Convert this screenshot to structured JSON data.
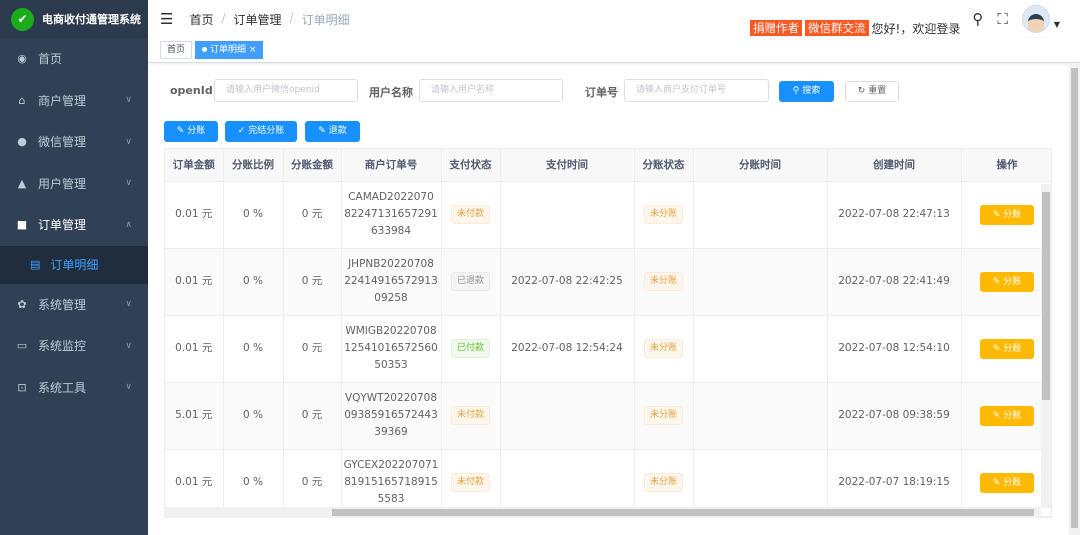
{
  "app": {
    "title": "电商收付通管理系统",
    "logo_icon": "wechat-pay-icon"
  },
  "sidebar": {
    "items": [
      {
        "label": "首页",
        "icon": "dashboard-icon"
      },
      {
        "label": "商户管理",
        "icon": "shop-icon"
      },
      {
        "label": "微信管理",
        "icon": "wechat-icon"
      },
      {
        "label": "用户管理",
        "icon": "user-icon"
      },
      {
        "label": "订单管理",
        "icon": "order-icon",
        "expanded": true
      },
      {
        "label": "系统管理",
        "icon": "gear-icon"
      },
      {
        "label": "系统监控",
        "icon": "monitor-icon"
      },
      {
        "label": "系统工具",
        "icon": "toolbox-icon"
      }
    ],
    "active_sub": "订单明细"
  },
  "header": {
    "breadcrumb": [
      "首页",
      "订单管理",
      "订单明细"
    ],
    "donate": "捐赠作者",
    "wechat_group": "微信群交流",
    "greeting": "您好!，欢迎登录"
  },
  "tags": {
    "home": "首页",
    "active": "订单明细"
  },
  "search": {
    "openid_label": "openId",
    "openid_placeholder": "请输入用户微信openid",
    "username_label": "用户名称",
    "username_placeholder": "请输入用户名称",
    "order_label": "订单号",
    "order_placeholder": "请输入商户支付订单号",
    "search_btn": "搜索",
    "reset_btn": "重置"
  },
  "actions": {
    "split": "分账",
    "finish_split": "完结分账",
    "refund": "退款"
  },
  "table": {
    "headers": [
      "订单金额",
      "分账比例",
      "分账金额",
      "商户订单号",
      "支付状态",
      "支付时间",
      "分账状态",
      "分账时间",
      "创建时间",
      "操作"
    ],
    "op_label": "分账",
    "rows": [
      {
        "amount": "0.01 元",
        "ratio": "0 %",
        "split_amount": "0 元",
        "order_no": [
          "CAMAD2022070",
          "82247131657291",
          "633984"
        ],
        "pay_status": "未付款",
        "pay_type": "unpaid",
        "pay_time": "",
        "split_status": "未分账",
        "split_time": "",
        "created": "2022-07-08 22:47:13"
      },
      {
        "amount": "0.01 元",
        "ratio": "0 %",
        "split_amount": "0 元",
        "order_no": [
          "JHPNB20220708",
          "22414916572913",
          "09258"
        ],
        "pay_status": "已退款",
        "pay_type": "refund",
        "pay_time": "2022-07-08 22:42:25",
        "split_status": "未分账",
        "split_time": "",
        "created": "2022-07-08 22:41:49"
      },
      {
        "amount": "0.01 元",
        "ratio": "0 %",
        "split_amount": "0 元",
        "order_no": [
          "WMIGB20220708",
          "12541016572560",
          "50353"
        ],
        "pay_status": "已付款",
        "pay_type": "paid",
        "pay_time": "2022-07-08 12:54:24",
        "split_status": "未分账",
        "split_time": "",
        "created": "2022-07-08 12:54:10"
      },
      {
        "amount": "5.01 元",
        "ratio": "0 %",
        "split_amount": "0 元",
        "order_no": [
          "VQYWT20220708",
          "09385916572443",
          "39369"
        ],
        "pay_status": "未付款",
        "pay_type": "unpaid",
        "pay_time": "",
        "split_status": "未分账",
        "split_time": "",
        "created": "2022-07-08 09:38:59"
      },
      {
        "amount": "0.01 元",
        "ratio": "0 %",
        "split_amount": "0 元",
        "order_no": [
          "GYCEX202207071",
          "81915165718915",
          "5583"
        ],
        "pay_status": "未付款",
        "pay_type": "unpaid",
        "pay_time": "",
        "split_status": "未分账",
        "split_time": "",
        "created": "2022-07-07 18:19:15"
      }
    ]
  }
}
